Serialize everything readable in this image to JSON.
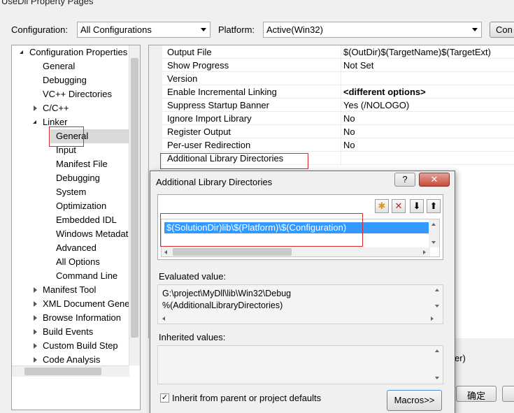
{
  "window": {
    "title": "UseDll Property Pages"
  },
  "toolbar": {
    "configuration_label": "Configuration:",
    "configuration_value": "All Configurations",
    "platform_label": "Platform:",
    "platform_value": "Active(Win32)",
    "config_manager_label": "Con"
  },
  "tree": {
    "items": [
      {
        "label": "Configuration Properties"
      },
      {
        "label": "General"
      },
      {
        "label": "Debugging"
      },
      {
        "label": "VC++ Directories"
      },
      {
        "label": "C/C++"
      },
      {
        "label": "Linker"
      },
      {
        "label": "General"
      },
      {
        "label": "Input"
      },
      {
        "label": "Manifest File"
      },
      {
        "label": "Debugging"
      },
      {
        "label": "System"
      },
      {
        "label": "Optimization"
      },
      {
        "label": "Embedded IDL"
      },
      {
        "label": "Windows Metadata"
      },
      {
        "label": "Advanced"
      },
      {
        "label": "All Options"
      },
      {
        "label": "Command Line"
      },
      {
        "label": "Manifest Tool"
      },
      {
        "label": "XML Document Generator"
      },
      {
        "label": "Browse Information"
      },
      {
        "label": "Build Events"
      },
      {
        "label": "Custom Build Step"
      },
      {
        "label": "Code Analysis"
      }
    ]
  },
  "properties": [
    {
      "name": "Output File",
      "value": "$(OutDir)$(TargetName)$(TargetExt)"
    },
    {
      "name": "Show Progress",
      "value": "Not Set"
    },
    {
      "name": "Version",
      "value": ""
    },
    {
      "name": "Enable Incremental Linking",
      "value": "<different options>"
    },
    {
      "name": "Suppress Startup Banner",
      "value": "Yes (/NOLOGO)"
    },
    {
      "name": "Ignore Import Library",
      "value": "No"
    },
    {
      "name": "Register Output",
      "value": "No"
    },
    {
      "name": "Per-user Redirection",
      "value": "No"
    },
    {
      "name": "Additional Library Directories",
      "value": ""
    }
  ],
  "behind_dialog": {
    "partial_text": "er)",
    "ok_button": "确定"
  },
  "dialog": {
    "title": "Additional Library Directories",
    "help_label": "?",
    "close_label": "✕",
    "entry": "$(SolutionDir)lib\\$(Platform)\\$(Configuration)",
    "evaluated_label": "Evaluated value:",
    "evaluated_lines": [
      "G:\\project\\MyDll\\lib\\Win32\\Debug",
      "%(AdditionalLibraryDirectories)"
    ],
    "inherited_label": "Inherited values:",
    "inherit_checkbox_label": "Inherit from parent or project defaults",
    "inherit_checked": true,
    "macros_button": "Macros>>"
  }
}
